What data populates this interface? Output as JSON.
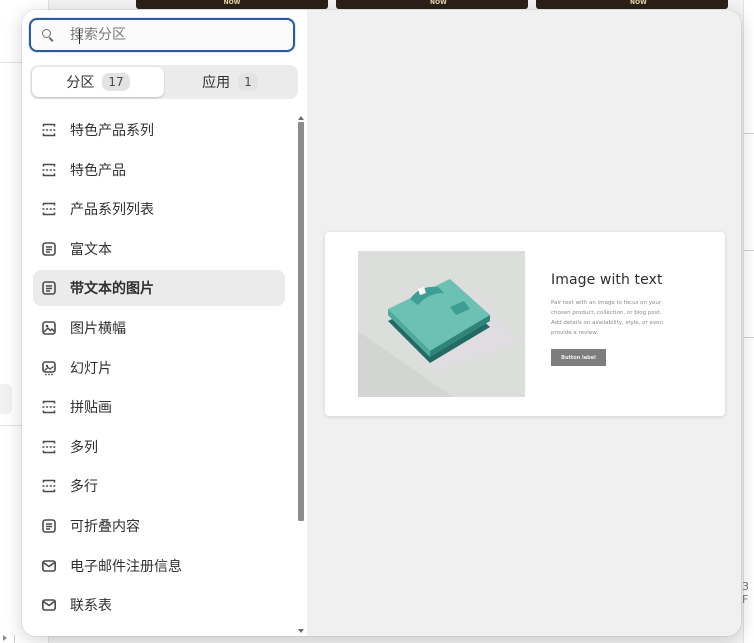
{
  "background": {
    "thumbnail_labels": [
      "NOW",
      "NOW",
      "NOW"
    ],
    "right_edge_text": "3 F"
  },
  "search": {
    "placeholder": "搜索分区",
    "value": "",
    "icon": "search-icon"
  },
  "tabs": [
    {
      "label": "分区",
      "count": "17",
      "active": true
    },
    {
      "label": "应用",
      "count": "1",
      "active": false
    }
  ],
  "sections": [
    {
      "label": "特色产品系列",
      "icon": "section-dashed-icon",
      "selected": false
    },
    {
      "label": "特色产品",
      "icon": "section-dashed-icon",
      "selected": false
    },
    {
      "label": "产品系列列表",
      "icon": "section-dashed-icon",
      "selected": false
    },
    {
      "label": "富文本",
      "icon": "text-block-icon",
      "selected": false
    },
    {
      "label": "带文本的图片",
      "icon": "text-block-icon",
      "selected": true
    },
    {
      "label": "图片横幅",
      "icon": "image-icon",
      "selected": false
    },
    {
      "label": "幻灯片",
      "icon": "slideshow-icon",
      "selected": false
    },
    {
      "label": "拼贴画",
      "icon": "section-dashed-icon",
      "selected": false
    },
    {
      "label": "多列",
      "icon": "section-dashed-icon",
      "selected": false
    },
    {
      "label": "多行",
      "icon": "section-dashed-icon",
      "selected": false
    },
    {
      "label": "可折叠内容",
      "icon": "text-block-icon",
      "selected": false
    },
    {
      "label": "电子邮件注册信息",
      "icon": "email-icon",
      "selected": false
    },
    {
      "label": "联系表",
      "icon": "email-icon",
      "selected": false
    }
  ],
  "preview": {
    "heading": "Image with text",
    "body": "Pair text with an image to focus on your chosen product, collection, or blog post. Add details on availability, style, or even provide a review.",
    "button_label": "Button label",
    "image_icon": "folded-tshirt-illustration"
  },
  "colors": {
    "focus_ring": "#2b5b9c",
    "tshirt_top": "#6cc0b4",
    "tshirt_mid": "#3d9f93",
    "tshirt_dark": "#246a64"
  }
}
